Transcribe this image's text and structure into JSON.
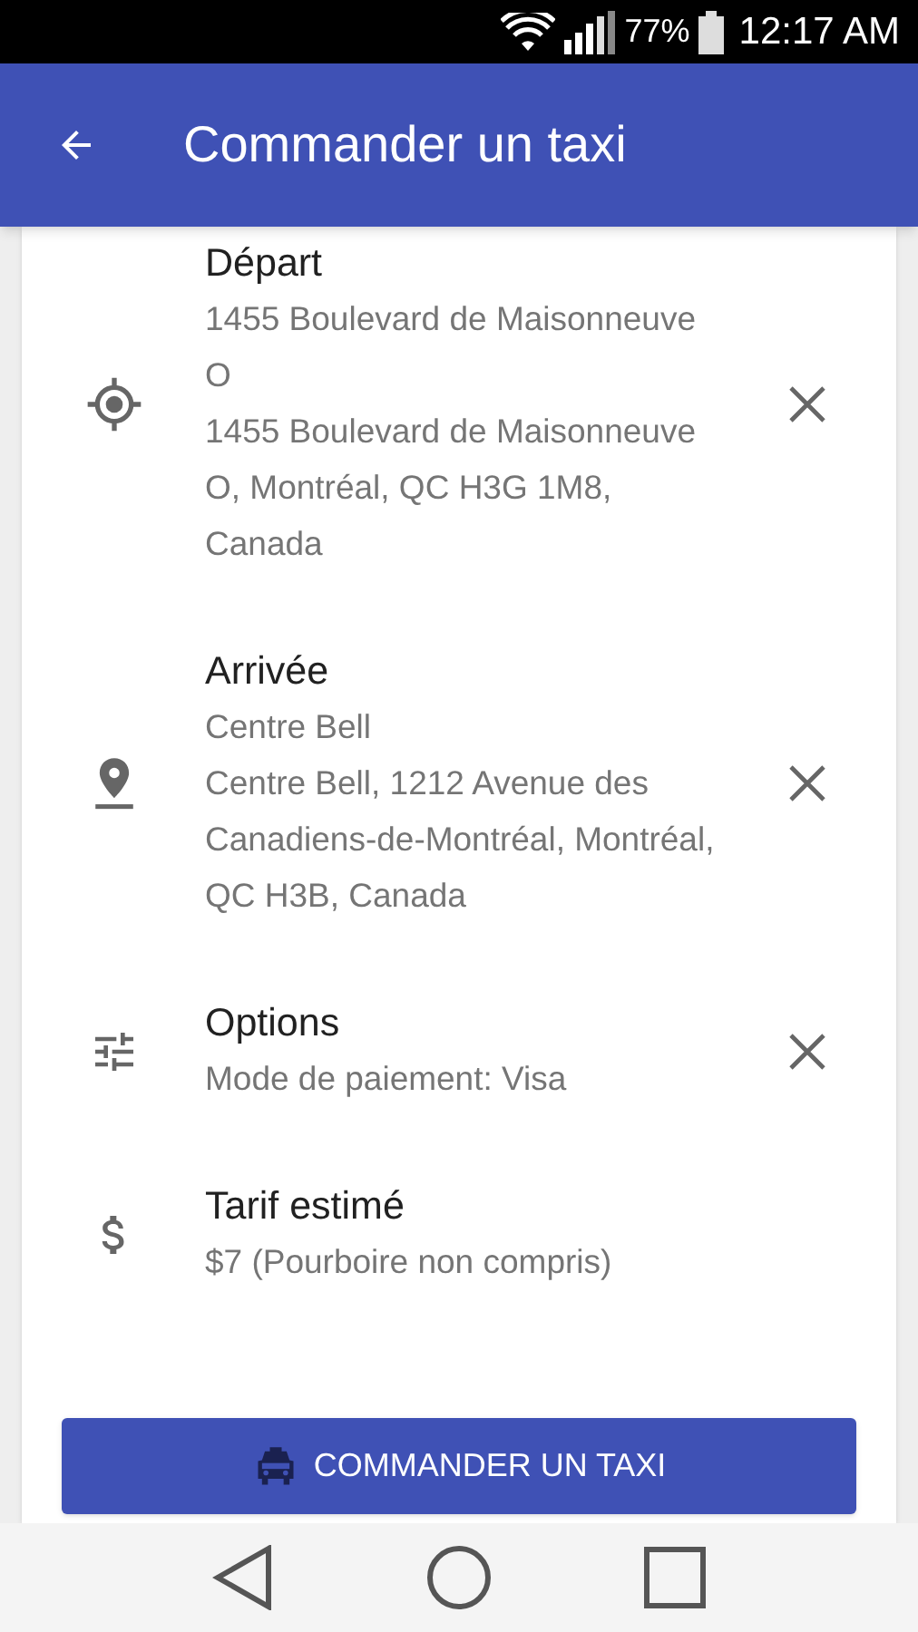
{
  "status_bar": {
    "battery": "77%",
    "time": "12:17 AM"
  },
  "app_bar": {
    "title": "Commander un taxi"
  },
  "rows": [
    {
      "kind": "origin",
      "title": "Départ",
      "lines": [
        "1455 Boulevard de Maisonneuve O",
        "1455 Boulevard de Maisonneuve O, Montréal, QC H3G 1M8, Canada"
      ],
      "clearable": true
    },
    {
      "kind": "destination",
      "title": "Arrivée",
      "lines": [
        "Centre Bell",
        "Centre Bell, 1212 Avenue des Canadiens-de-Montréal, Montréal, QC H3B, Canada"
      ],
      "clearable": true
    },
    {
      "kind": "options",
      "title": "Options",
      "lines": [
        "Mode de paiement: Visa"
      ],
      "clearable": true
    },
    {
      "kind": "fare",
      "title": "Tarif estimé",
      "lines": [
        "$7 (Pourboire non compris)"
      ],
      "clearable": false
    }
  ],
  "order_button": {
    "label": "COMMANDER UN TAXI"
  }
}
